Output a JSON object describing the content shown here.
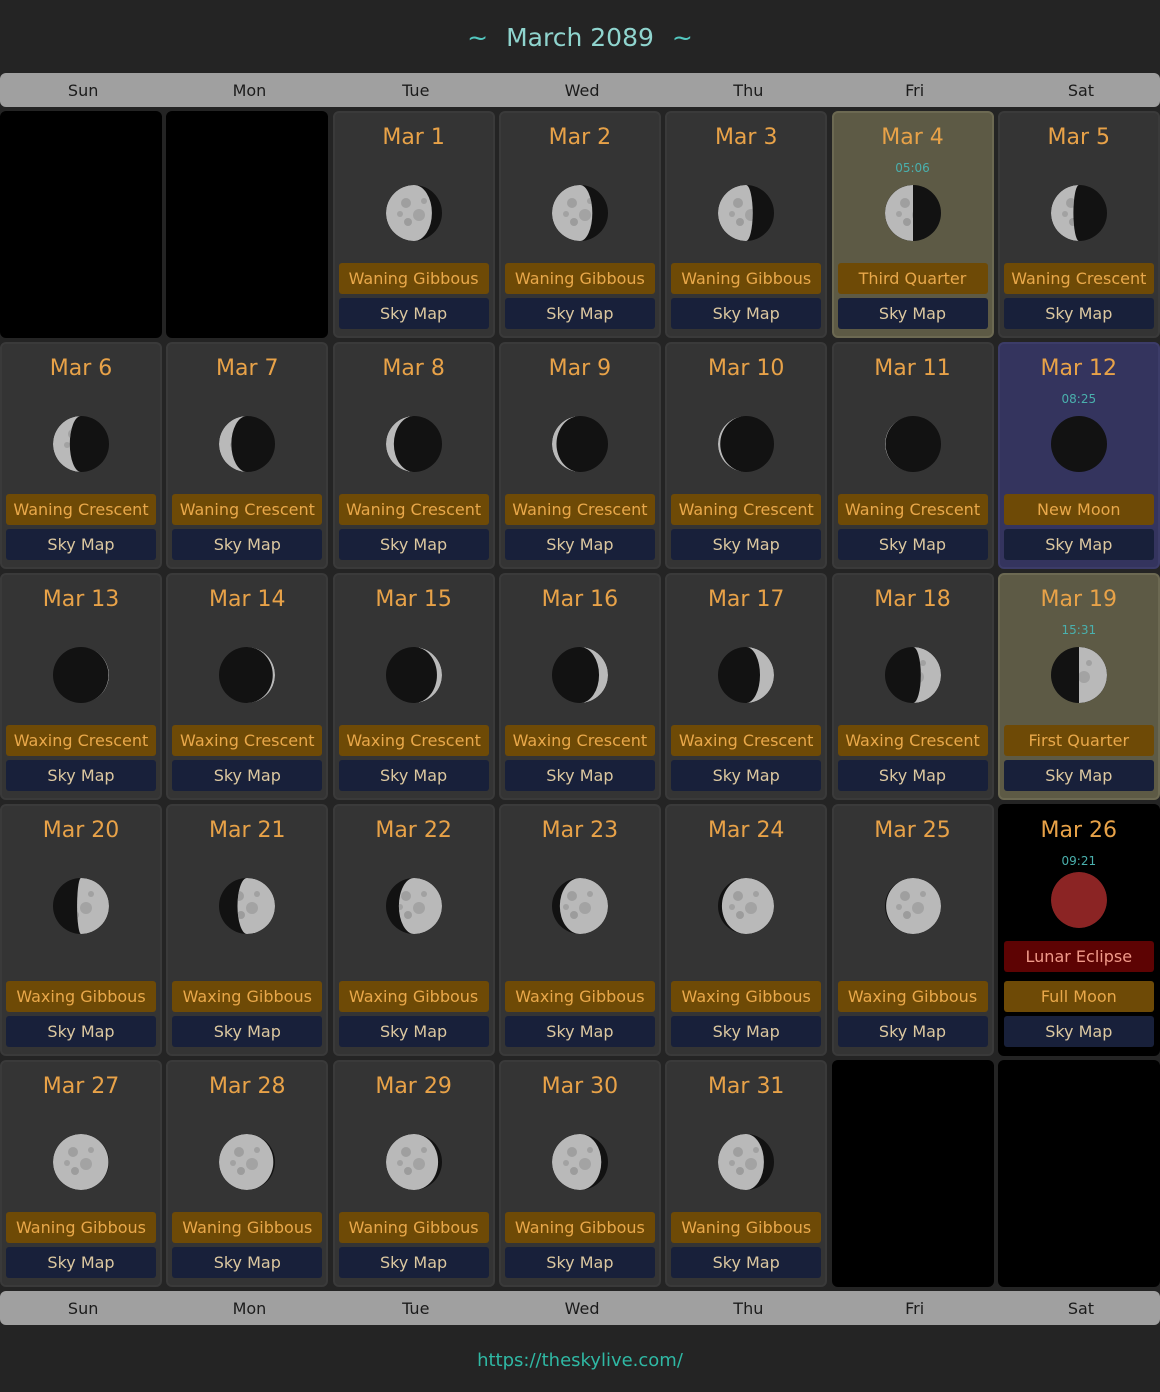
{
  "header": {
    "title": "March 2089",
    "tilde": "~"
  },
  "weekdays": [
    "Sun",
    "Mon",
    "Tue",
    "Wed",
    "Thu",
    "Fri",
    "Sat"
  ],
  "sky_map_label": "Sky Map",
  "first_weekday_index": 2,
  "days": [
    {
      "date": "Mar 1",
      "phase": "Waning Gibbous",
      "illum": 0.82,
      "side": "waning"
    },
    {
      "date": "Mar 2",
      "phase": "Waning Gibbous",
      "illum": 0.72,
      "side": "waning"
    },
    {
      "date": "Mar 3",
      "phase": "Waning Gibbous",
      "illum": 0.62,
      "side": "waning"
    },
    {
      "date": "Mar 4",
      "phase": "Third Quarter",
      "illum": 0.5,
      "side": "waning",
      "time": "05:06",
      "highlight": "quarter"
    },
    {
      "date": "Mar 5",
      "phase": "Waning Crescent",
      "illum": 0.4,
      "side": "waning"
    },
    {
      "date": "Mar 6",
      "phase": "Waning Crescent",
      "illum": 0.3,
      "side": "waning"
    },
    {
      "date": "Mar 7",
      "phase": "Waning Crescent",
      "illum": 0.22,
      "side": "waning"
    },
    {
      "date": "Mar 8",
      "phase": "Waning Crescent",
      "illum": 0.14,
      "side": "waning"
    },
    {
      "date": "Mar 9",
      "phase": "Waning Crescent",
      "illum": 0.08,
      "side": "waning"
    },
    {
      "date": "Mar 10",
      "phase": "Waning Crescent",
      "illum": 0.04,
      "side": "waning"
    },
    {
      "date": "Mar 11",
      "phase": "Waning Crescent",
      "illum": 0.01,
      "side": "waning"
    },
    {
      "date": "Mar 12",
      "phase": "New Moon",
      "illum": 0.0,
      "side": "waning",
      "time": "08:25",
      "highlight": "newmoon"
    },
    {
      "date": "Mar 13",
      "phase": "Waxing Crescent",
      "illum": 0.01,
      "side": "waxing"
    },
    {
      "date": "Mar 14",
      "phase": "Waxing Crescent",
      "illum": 0.04,
      "side": "waxing"
    },
    {
      "date": "Mar 15",
      "phase": "Waxing Crescent",
      "illum": 0.09,
      "side": "waxing"
    },
    {
      "date": "Mar 16",
      "phase": "Waxing Crescent",
      "illum": 0.16,
      "side": "waxing"
    },
    {
      "date": "Mar 17",
      "phase": "Waxing Crescent",
      "illum": 0.25,
      "side": "waxing"
    },
    {
      "date": "Mar 18",
      "phase": "Waxing Crescent",
      "illum": 0.36,
      "side": "waxing"
    },
    {
      "date": "Mar 19",
      "phase": "First Quarter",
      "illum": 0.5,
      "side": "waxing",
      "time": "15:31",
      "highlight": "quarter"
    },
    {
      "date": "Mar 20",
      "phase": "Waxing Gibbous",
      "illum": 0.57,
      "side": "waxing"
    },
    {
      "date": "Mar 21",
      "phase": "Waxing Gibbous",
      "illum": 0.67,
      "side": "waxing"
    },
    {
      "date": "Mar 22",
      "phase": "Waxing Gibbous",
      "illum": 0.77,
      "side": "waxing"
    },
    {
      "date": "Mar 23",
      "phase": "Waxing Gibbous",
      "illum": 0.86,
      "side": "waxing"
    },
    {
      "date": "Mar 24",
      "phase": "Waxing Gibbous",
      "illum": 0.93,
      "side": "waxing"
    },
    {
      "date": "Mar 25",
      "phase": "Waxing Gibbous",
      "illum": 0.98,
      "side": "waxing"
    },
    {
      "date": "Mar 26",
      "phase": "Full Moon",
      "illum": 1.0,
      "side": "waxing",
      "time": "09:21",
      "highlight": "eclipse",
      "event": "Lunar Eclipse"
    },
    {
      "date": "Mar 27",
      "phase": "Waning Gibbous",
      "illum": 0.99,
      "side": "waning"
    },
    {
      "date": "Mar 28",
      "phase": "Waning Gibbous",
      "illum": 0.97,
      "side": "waning"
    },
    {
      "date": "Mar 29",
      "phase": "Waning Gibbous",
      "illum": 0.93,
      "side": "waning"
    },
    {
      "date": "Mar 30",
      "phase": "Waning Gibbous",
      "illum": 0.88,
      "side": "waning"
    },
    {
      "date": "Mar 31",
      "phase": "Waning Gibbous",
      "illum": 0.82,
      "side": "waning"
    }
  ],
  "footer": {
    "link": "https://theskylive.com/"
  },
  "colors": {
    "background": "#242424",
    "title": "#8fd4ce",
    "date_text": "#e8a248",
    "phase_label_bg": "#6e4a06",
    "sky_map_bg": "#18203a",
    "quarter_bg": "#5d5a45",
    "new_moon_bg": "#34345e",
    "eclipse_label_bg": "#5d0303",
    "footer_link": "#2fb8a4"
  }
}
